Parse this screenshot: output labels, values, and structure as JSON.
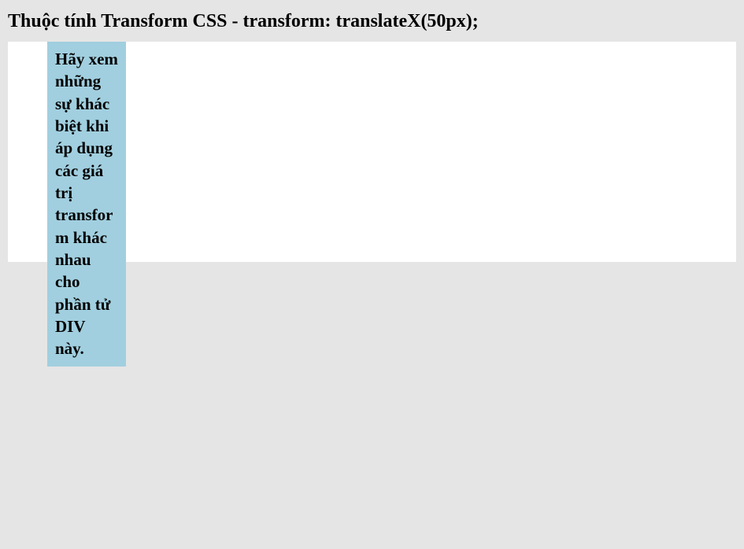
{
  "heading": "Thuộc tính Transform CSS - transform: translateX(50px);",
  "demo": {
    "box_text": "Hãy xem những sự khác biệt khi áp dụng các giá trị transform khác nhau cho phần tử DIV này.",
    "transform_value": "translateX(50px)",
    "box_color": "#A1CFDF",
    "container_color": "#FFFFFF",
    "page_background": "#E5E5E5"
  }
}
